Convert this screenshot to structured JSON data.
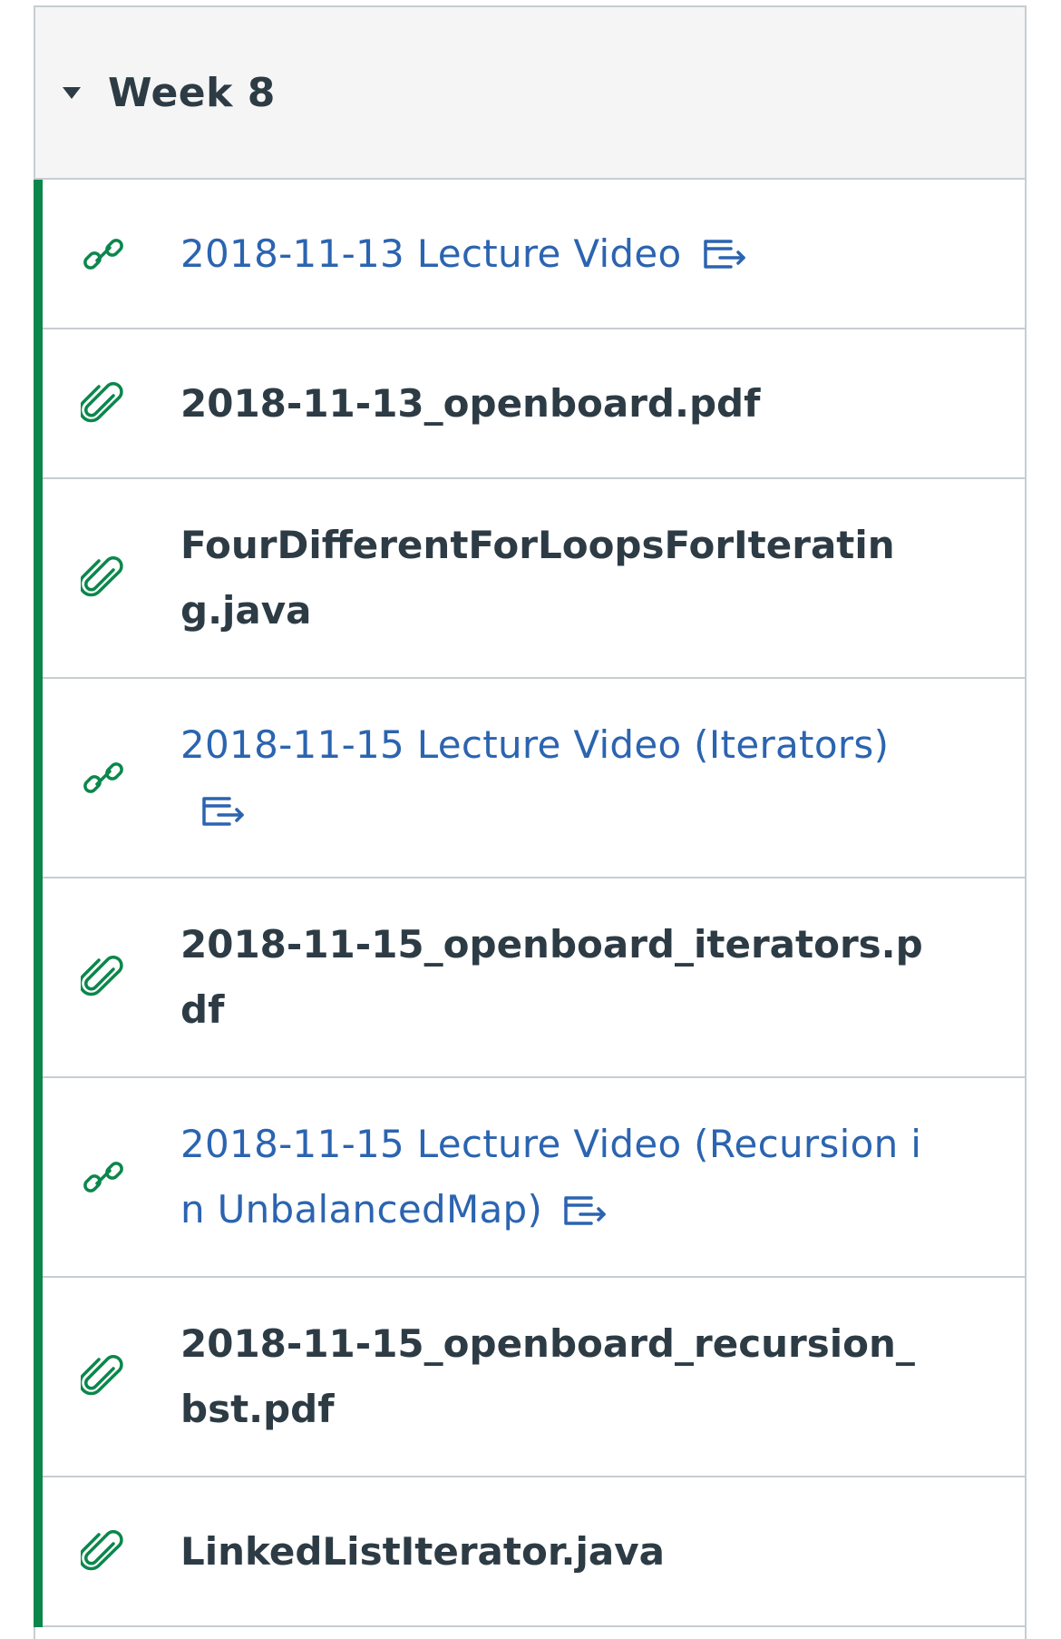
{
  "module": {
    "title": "Week 8"
  },
  "colors": {
    "accent_green": "#0b874b",
    "link_blue": "#2b64b0",
    "text_dark": "#2d3b45"
  },
  "items": [
    {
      "type": "link",
      "icon": "link-icon",
      "label": "2018-11-13 Lecture Video",
      "external": true
    },
    {
      "type": "file",
      "icon": "paperclip-icon",
      "label": "2018-11-13_openboard.pdf",
      "external": false
    },
    {
      "type": "file",
      "icon": "paperclip-icon",
      "label": "FourDifferentForLoopsForIterating.java",
      "external": false
    },
    {
      "type": "link",
      "icon": "link-icon",
      "label": "2018-11-15 Lecture Video (Iterators)",
      "external": true
    },
    {
      "type": "file",
      "icon": "paperclip-icon",
      "label": "2018-11-15_openboard_iterators.pdf",
      "external": false
    },
    {
      "type": "link",
      "icon": "link-icon",
      "label": "2018-11-15 Lecture Video (Recursion in UnbalancedMap)",
      "external": true
    },
    {
      "type": "file",
      "icon": "paperclip-icon",
      "label": "2018-11-15_openboard_recursion_bst.pdf",
      "external": false
    },
    {
      "type": "file",
      "icon": "paperclip-icon",
      "label": "LinkedListIterator.java",
      "external": false
    }
  ]
}
